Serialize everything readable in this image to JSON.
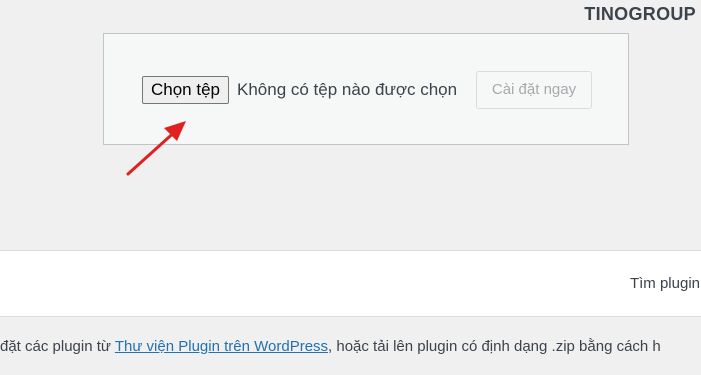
{
  "brand": {
    "part1": "TINO",
    "part2": "GROUP"
  },
  "upload": {
    "choose_file_label": "Chọn tệp",
    "no_file_text": "Không có tệp nào được chọn",
    "install_now_label": "Cài đặt ngay"
  },
  "filter_bar": {
    "search_label": "Tìm plugin"
  },
  "description": {
    "prefix": "đặt các plugin từ ",
    "link_text": "Thư viện Plugin trên WordPress",
    "suffix": ", hoặc tải lên plugin có định dạng .zip bằng cách h"
  },
  "colors": {
    "page_background": "#f0f0f1",
    "link": "#2271b1",
    "arrow": "#e0211f"
  }
}
